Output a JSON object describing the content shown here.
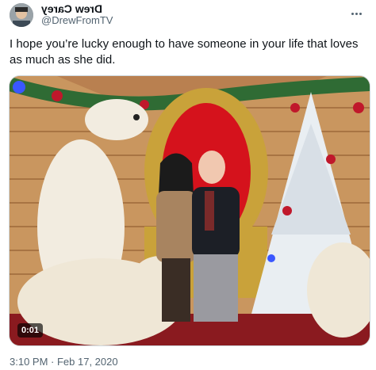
{
  "author": {
    "display_name": "Drew Carey",
    "handle": "@DrewFromTV"
  },
  "tweet": {
    "text": "I hope you’re lucky enough to have someone in your life that loves as much as she did.",
    "timestamp": "3:10 PM · Feb 17, 2020"
  },
  "media": {
    "type": "video",
    "duration": "0:01"
  },
  "icons": {
    "more": "more-options-icon"
  },
  "colors": {
    "text_primary": "#0f1419",
    "text_secondary": "#536471",
    "border": "#cfd9de"
  }
}
